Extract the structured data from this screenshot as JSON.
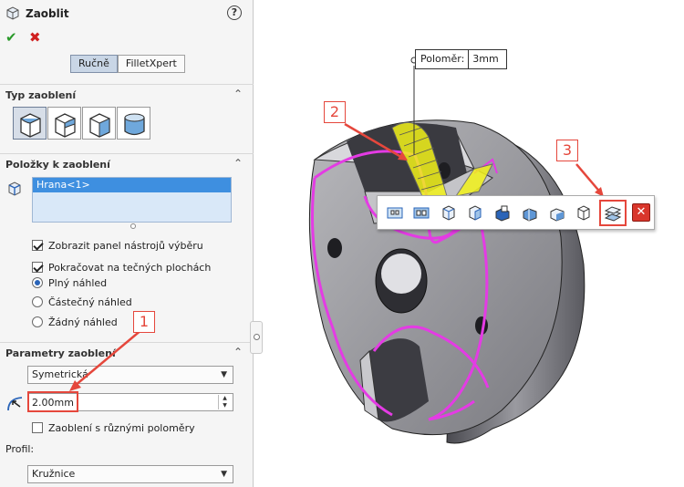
{
  "panel": {
    "title": "Zaoblit",
    "help_label": "?",
    "ok_symbol": "✔",
    "cancel_symbol": "✖",
    "tabs": [
      {
        "label": "Ručně",
        "active": true
      },
      {
        "label": "FilletXpert",
        "active": false
      }
    ],
    "fillet_type": {
      "heading": "Typ zaoblení",
      "buttons": [
        "constant-radius-fillet-icon",
        "variable-radius-fillet-icon",
        "face-fillet-icon",
        "full-round-fillet-icon"
      ]
    },
    "items": {
      "heading": "Položky k zaoblení",
      "list": [
        "Hrana<1>"
      ],
      "options": [
        {
          "type": "checkbox",
          "label": "Zobrazit panel nástrojů výběru",
          "checked": true
        },
        {
          "type": "checkbox",
          "label": "Pokračovat na tečných plochách",
          "checked": true
        },
        {
          "type": "radio",
          "label": "Plný náhled",
          "checked": true
        },
        {
          "type": "radio",
          "label": "Částečný náhled",
          "checked": false
        },
        {
          "type": "radio",
          "label": "Žádný náhled",
          "checked": false
        }
      ]
    },
    "params": {
      "heading": "Parametry zaoblení",
      "method": "Symetrická",
      "radius": "2.00mm",
      "multi_radius_label": "Zaoblení s různými poloměry",
      "multi_radius_checked": false,
      "profile_label": "Profil:",
      "profile": "Kružnice"
    }
  },
  "viewport": {
    "radius_tag": {
      "label": "Poloměr:",
      "value": "3mm"
    },
    "selection_toolbar": {
      "buttons": [
        "select-connected-loop-icon",
        "select-tangent-loop-icon",
        "select-feature-edges-icon",
        "select-connected-edges-icon",
        "select-open-loop-icon",
        "select-convex-edges-icon",
        "select-concave-edges-icon",
        "select-face-edges-icon",
        "select-feature-faces-icon",
        "close-icon"
      ]
    },
    "accent_magenta": "#e43be4",
    "accent_yellow": "#f2f21a"
  },
  "callouts": {
    "one": "1",
    "two": "2",
    "three": "3"
  },
  "callout_color": "#e5473c"
}
